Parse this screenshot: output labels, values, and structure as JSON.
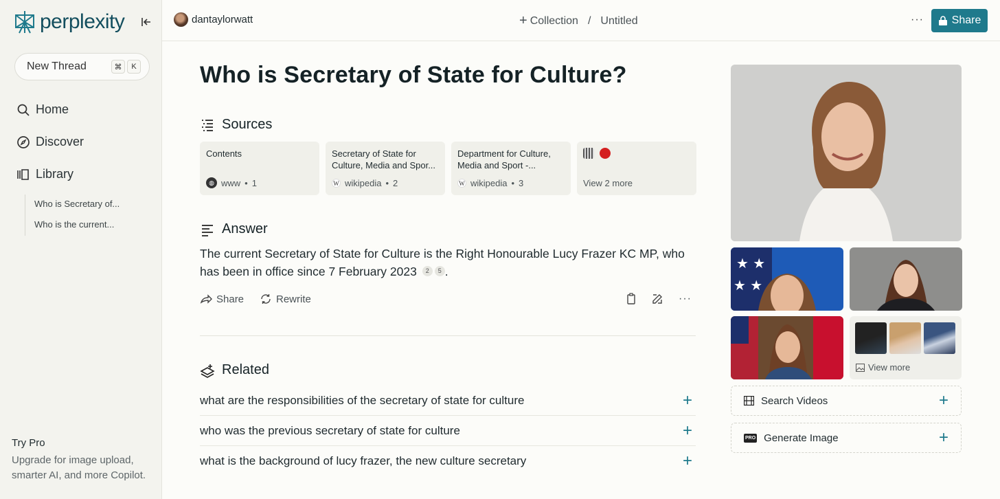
{
  "sidebar": {
    "logo_text": "perplexity",
    "new_thread": {
      "label": "New Thread",
      "shortcut": [
        "⌘",
        "K"
      ]
    },
    "nav": [
      {
        "label": "Home",
        "icon": "search-icon"
      },
      {
        "label": "Discover",
        "icon": "compass-icon"
      },
      {
        "label": "Library",
        "icon": "library-icon"
      }
    ],
    "library_items": [
      "Who is Secretary of...",
      "Who is the current..."
    ],
    "try_pro": {
      "title": "Try Pro",
      "description": "Upgrade for image upload, smarter AI, and more Copilot."
    }
  },
  "topbar": {
    "username": "dantaylorwatt",
    "collection_label": "Collection",
    "separator": "/",
    "page_name": "Untitled",
    "share_label": "Share"
  },
  "main": {
    "title": "Who is Secretary of State for Culture?",
    "sources_heading": "Sources",
    "sources": [
      {
        "title": "Contents",
        "site": "www",
        "index": "1"
      },
      {
        "title": "Secretary of State for Culture, Media and Spor...",
        "site": "wikipedia",
        "index": "2"
      },
      {
        "title": "Department for Culture, Media and Sport -...",
        "site": "wikipedia",
        "index": "3"
      }
    ],
    "view_more_sources": "View 2 more",
    "answer_heading": "Answer",
    "answer_text": "The current Secretary of State for Culture is the Right Honourable Lucy Frazer KC MP, who has been in office since 7 February 2023",
    "citations": [
      "2",
      "5"
    ],
    "answer_end": ".",
    "actions": {
      "share": "Share",
      "rewrite": "Rewrite"
    },
    "related_heading": "Related",
    "related": [
      "what are the responsibilities of the secretary of state for culture",
      "who was the previous secretary of state for culture",
      "what is the background of lucy frazer, the new culture secretary"
    ]
  },
  "right": {
    "view_more_label": "View more",
    "search_videos": "Search Videos",
    "generate_image": "Generate Image",
    "pro_badge": "PRO"
  },
  "colors": {
    "accent": "#1f7a8c",
    "sidebar_bg": "#f3f3ee",
    "main_bg": "#fcfcf9"
  }
}
